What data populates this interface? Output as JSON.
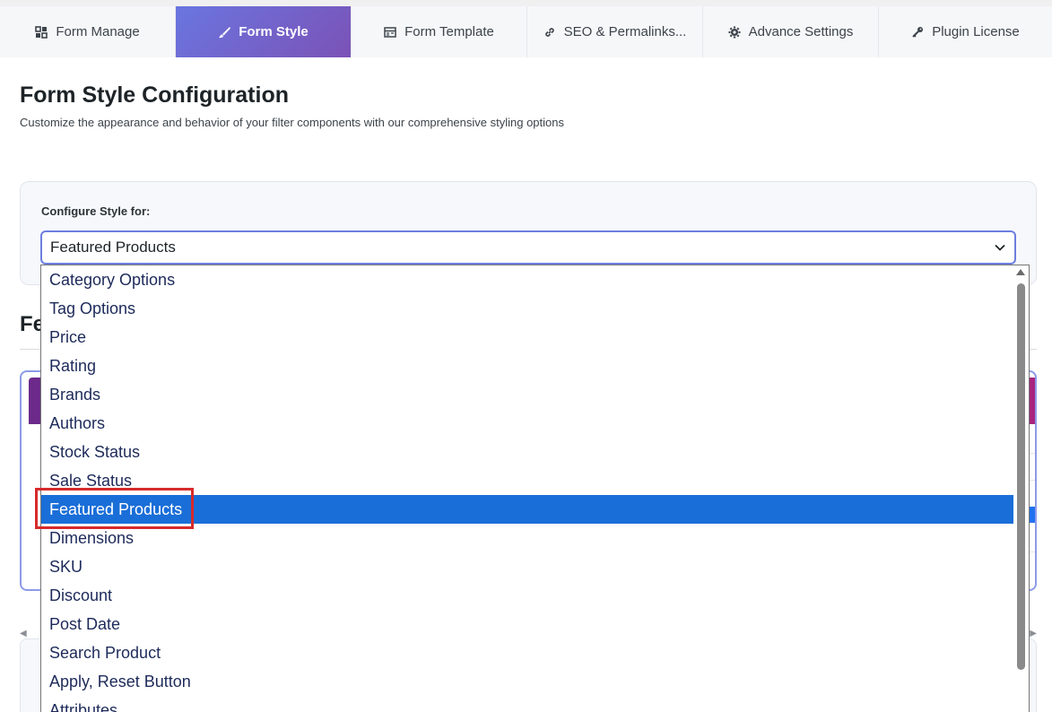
{
  "tabs": [
    {
      "label": "Form Manage",
      "icon": "grid-icon",
      "active": false
    },
    {
      "label": "Form Style",
      "icon": "brush-icon",
      "active": true
    },
    {
      "label": "Form Template",
      "icon": "table-icon",
      "active": false
    },
    {
      "label": "SEO & Permalinks...",
      "icon": "link-icon",
      "active": false
    },
    {
      "label": "Advance Settings",
      "icon": "gear-icon",
      "active": false
    },
    {
      "label": "Plugin License",
      "icon": "key-icon",
      "active": false
    }
  ],
  "page": {
    "title": "Form Style Configuration",
    "subtitle": "Customize the appearance and behavior of your filter components with our comprehensive styling options"
  },
  "config": {
    "label": "Configure Style for:",
    "selected_value": "Featured Products",
    "options": [
      "Category Options",
      "Tag Options",
      "Price",
      "Rating",
      "Brands",
      "Authors",
      "Stock Status",
      "Sale Status",
      "Featured Products",
      "Dimensions",
      "SKU",
      "Discount",
      "Post Date",
      "Search Product",
      "Apply, Reset Button",
      "Attributes"
    ],
    "selected_index": 8
  },
  "background": {
    "section_heading_visible": "Fe"
  },
  "colors": {
    "accent_start": "#6a76e0",
    "accent_end": "#7b52b6",
    "selection": "#1a6ed8",
    "highlight_box": "#d62a2a"
  }
}
